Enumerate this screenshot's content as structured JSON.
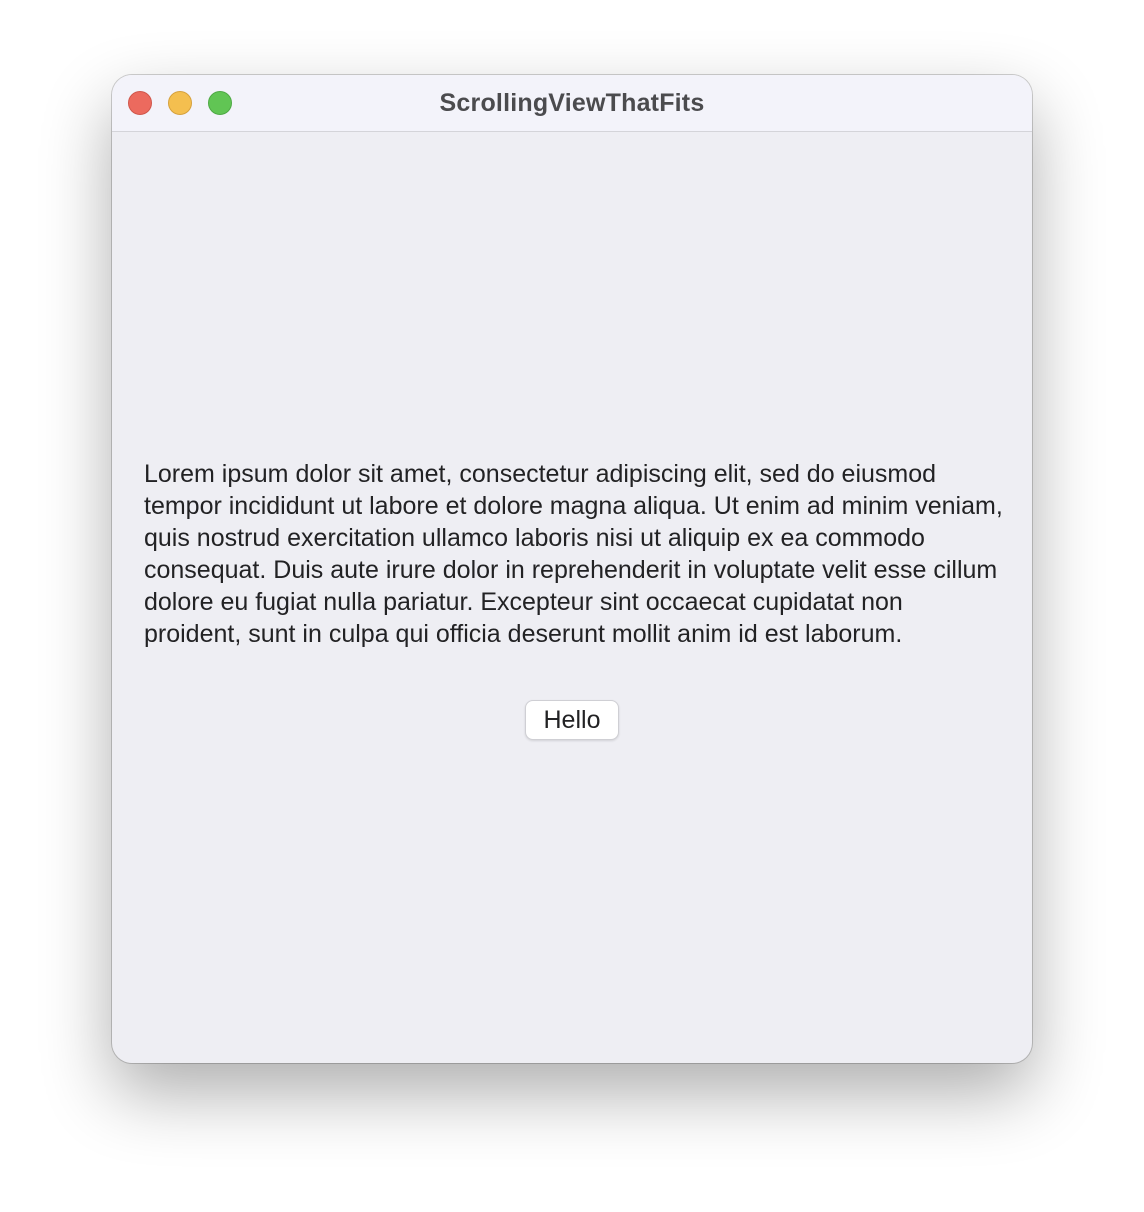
{
  "window": {
    "title": "ScrollingViewThatFits",
    "controls": {
      "close_color": "#ec6a5e",
      "minimize_color": "#f4bf4f",
      "zoom_color": "#61c554"
    }
  },
  "content": {
    "paragraph": "Lorem ipsum dolor sit amet, consectetur adipiscing elit, sed do eiusmod tempor incididunt ut labore et dolore magna aliqua. Ut enim ad minim veniam, quis nostrud exercitation ullamco laboris nisi ut aliquip ex ea commodo consequat. Duis aute irure dolor in reprehenderit in voluptate velit esse cillum dolore eu fugiat nulla pariatur. Excepteur sint occaecat cupidatat non proident, sunt in culpa qui officia deserunt mollit anim id est laborum.",
    "button_label": "Hello"
  }
}
